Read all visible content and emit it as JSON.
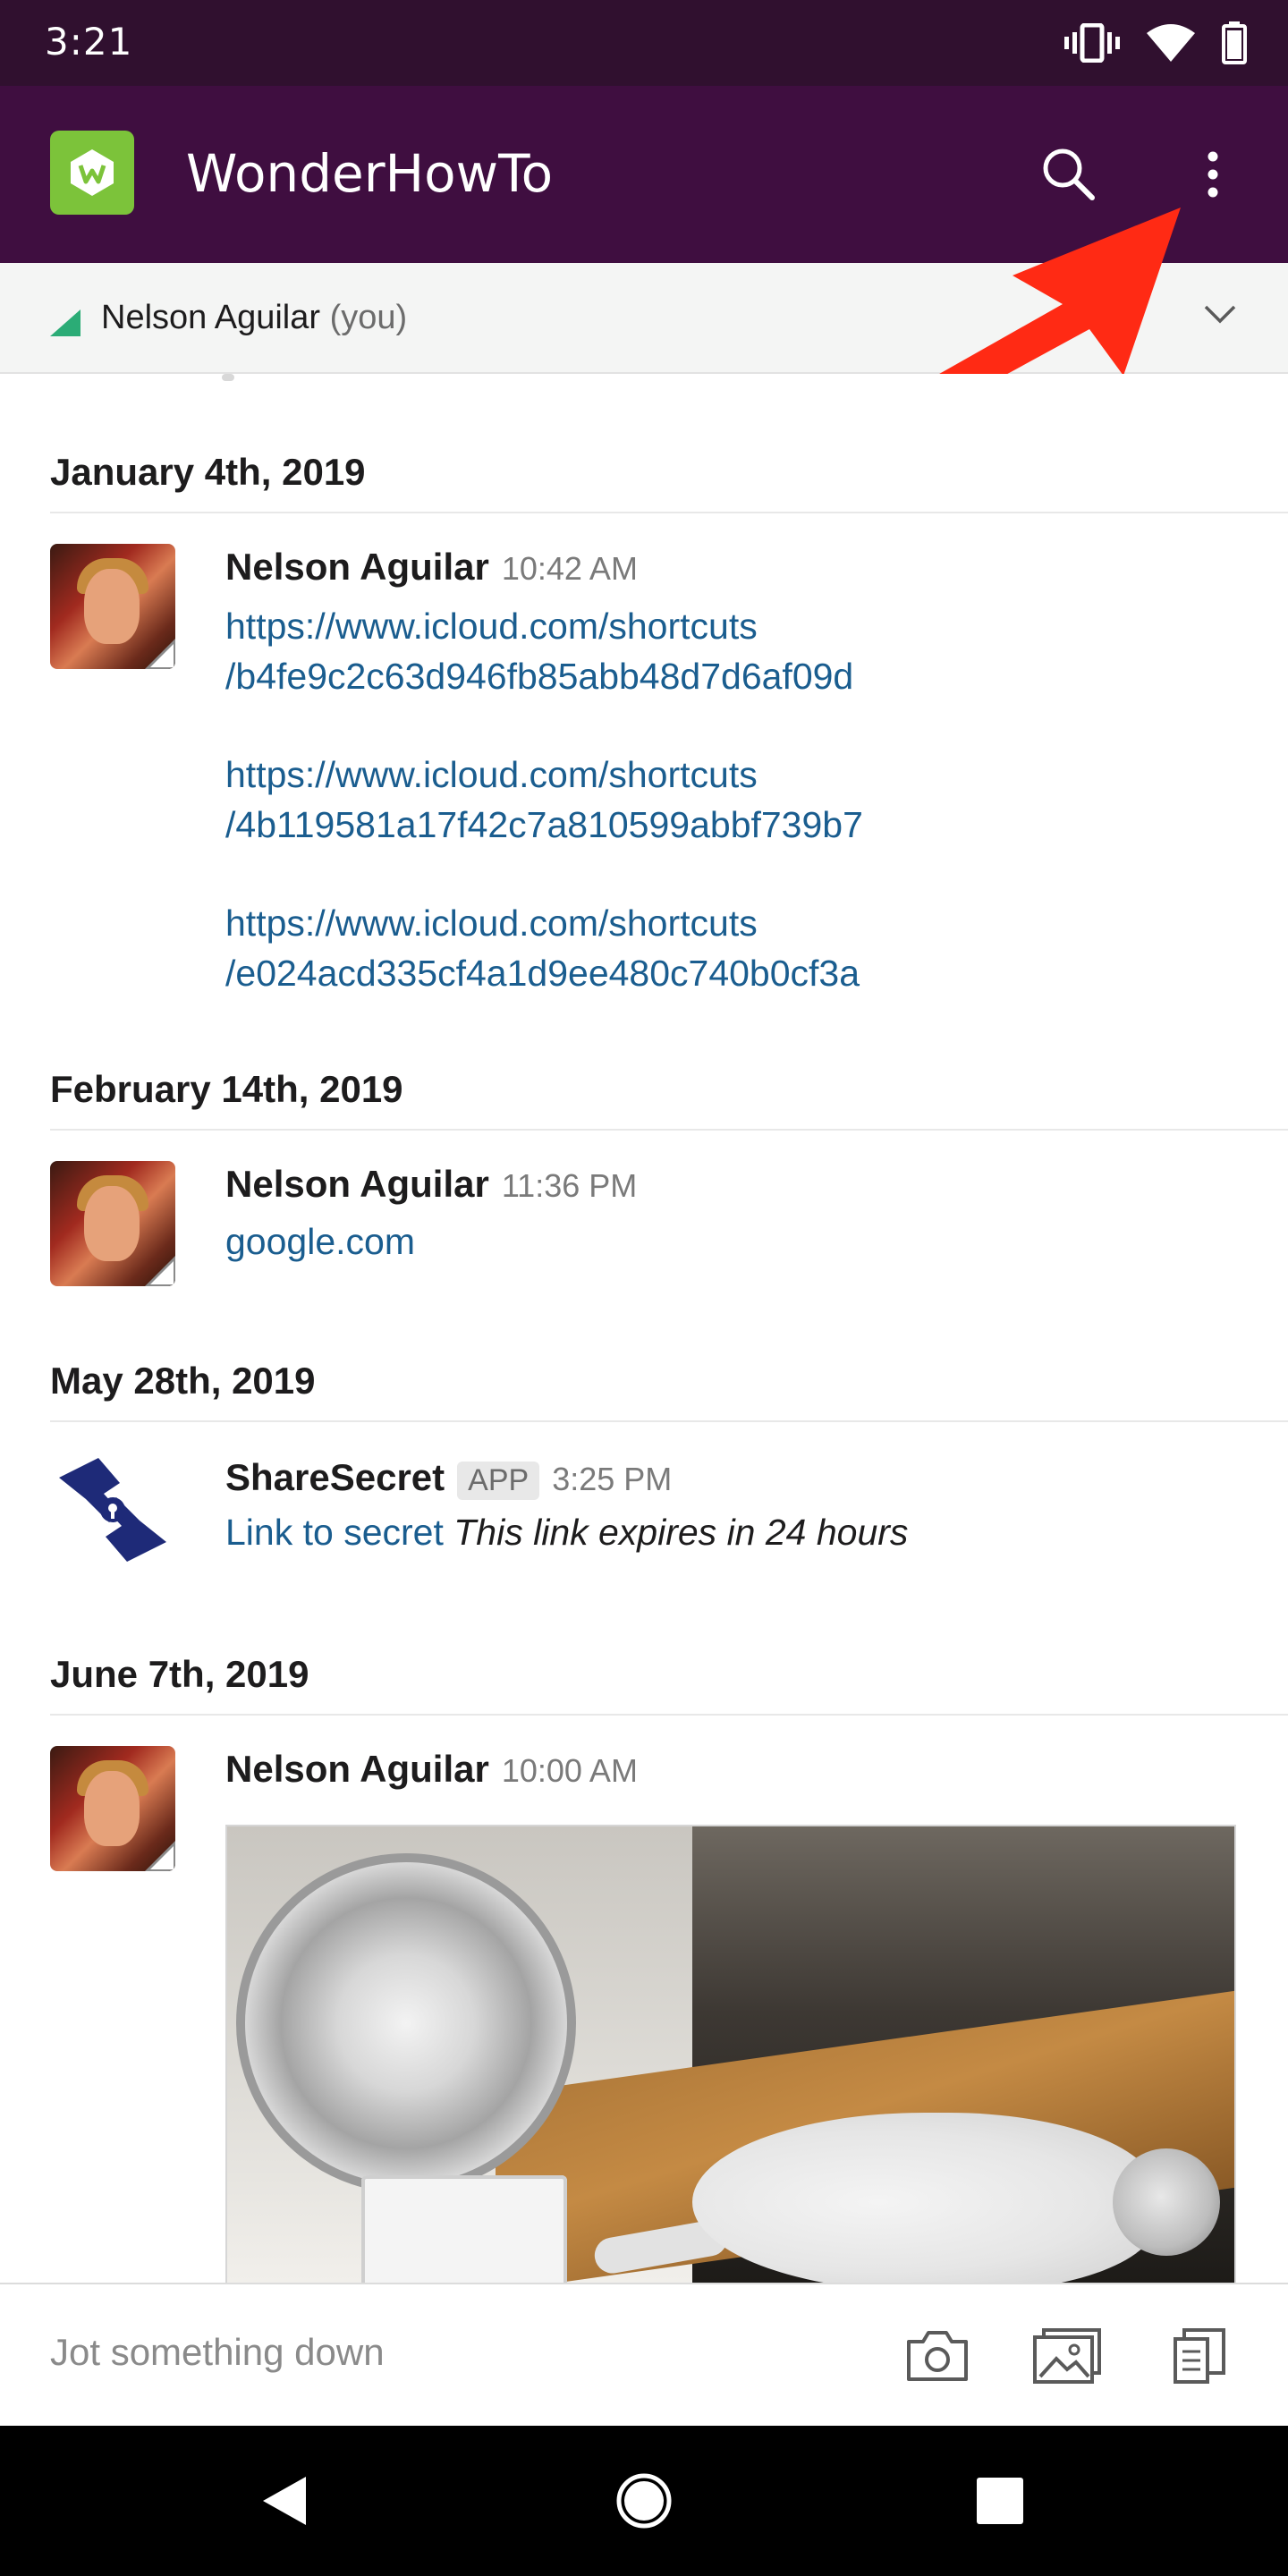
{
  "status_bar": {
    "time": "3:21",
    "icons": [
      "vibrate-icon",
      "wifi-icon",
      "battery-icon"
    ]
  },
  "app_bar": {
    "title": "WonderHowTo",
    "logo_color": "#7cc33a",
    "background": "#3f0e40",
    "actions": [
      "search-icon",
      "more-vert-icon"
    ]
  },
  "channel": {
    "name": "Nelson Aguilar",
    "suffix": "(you)",
    "presence_color": "#2bac76"
  },
  "feed": [
    {
      "date": "January 4th, 2019",
      "author": "Nelson Aguilar",
      "time": "10:42 AM",
      "links": [
        [
          "https://www.icloud.com/shortcuts",
          "/b4fe9c2c63d946fb85abb48d7d6af09d"
        ],
        [
          "https://www.icloud.com/shortcuts",
          "/4b119581a17f42c7a810599abbf739b7"
        ],
        [
          "https://www.icloud.com/shortcuts",
          "/e024acd335cf4a1d9ee480c740b0cf3a"
        ]
      ]
    },
    {
      "date": "February 14th, 2019",
      "author": "Nelson Aguilar",
      "time": "11:36 PM",
      "link": "google.com"
    },
    {
      "date": "May 28th, 2019",
      "author": "ShareSecret",
      "tag": "APP",
      "time": "3:25 PM",
      "link": "Link to secret",
      "text": "This link expires in 24 hours"
    },
    {
      "date": "June 7th, 2019",
      "author": "Nelson Aguilar",
      "time": "10:00 AM",
      "attachment": "gif-image"
    }
  ],
  "composer": {
    "placeholder": "Jot something down",
    "actions": [
      "camera-icon",
      "gallery-icon",
      "files-icon"
    ]
  },
  "nav_bar": {
    "buttons": [
      "back-icon",
      "home-icon",
      "recents-icon"
    ]
  }
}
